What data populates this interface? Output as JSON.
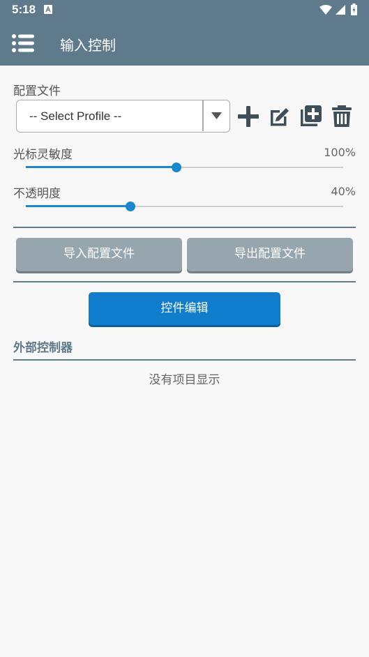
{
  "status_bar": {
    "time": "5:18"
  },
  "app_bar": {
    "title": "输入控制"
  },
  "profile": {
    "label": "配置文件",
    "selected": "-- Select Profile --"
  },
  "cursor_sensitivity": {
    "label": "光标灵敏度",
    "value_text": "100%",
    "position": 0.475
  },
  "opacity": {
    "label": "不透明度",
    "value_text": "40%",
    "position": 0.33
  },
  "buttons": {
    "import_label": "导入配置文件",
    "export_label": "导出配置文件",
    "edit_controls_label": "控件编辑"
  },
  "external_controllers": {
    "header": "外部控制器",
    "empty_text": "没有项目显示"
  },
  "colors": {
    "primary": "#5f7a8b",
    "accent": "#0f7dcc",
    "secondary_button": "#97a6ae"
  },
  "icons": [
    "menu-icon",
    "add-icon",
    "edit-icon",
    "duplicate-icon",
    "delete-icon",
    "chevron-down-icon"
  ]
}
